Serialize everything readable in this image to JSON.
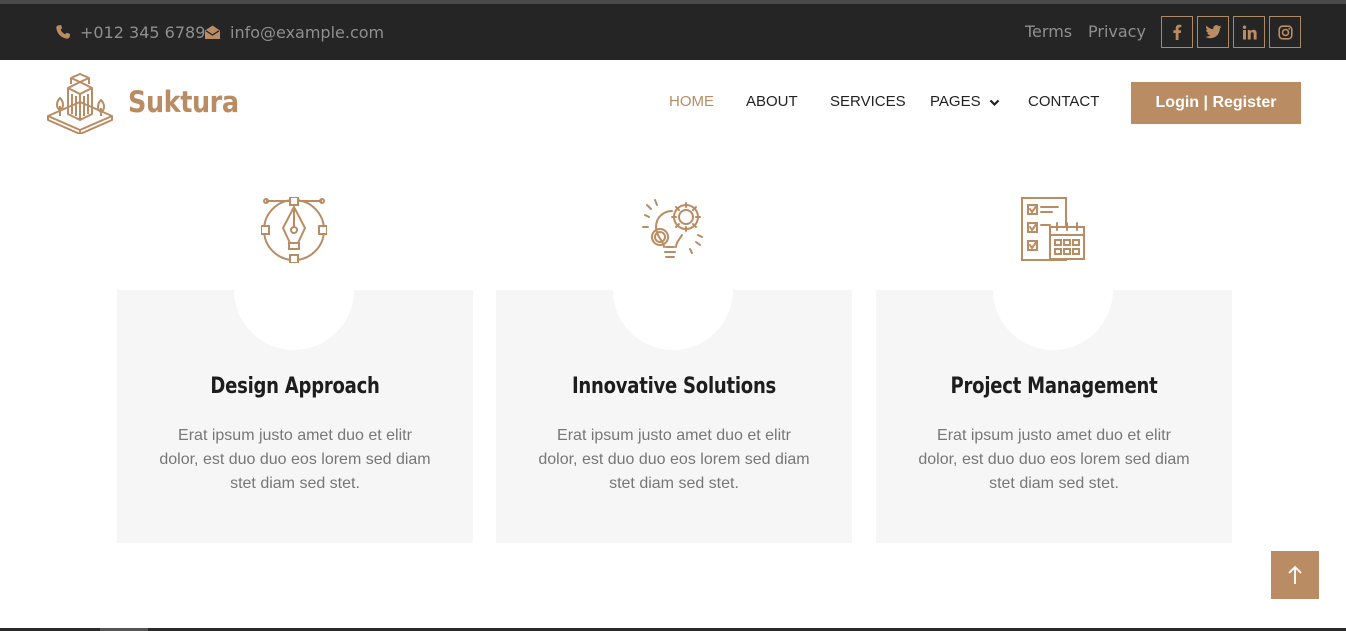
{
  "topbar": {
    "phone": "+012 345 6789",
    "email": "info@example.com",
    "terms": "Terms",
    "privacy": "Privacy",
    "social": [
      "facebook-icon",
      "twitter-icon",
      "linkedin-icon",
      "instagram-icon"
    ]
  },
  "brand": {
    "name": "Suktura",
    "logo_icon": "building-icon"
  },
  "nav": {
    "home": "HOME",
    "about": "ABOUT",
    "services": "SERVICES",
    "pages": "PAGES",
    "contact": "CONTACT",
    "active": "HOME",
    "login": "Login | Register"
  },
  "cards": [
    {
      "icon": "pen-tool-icon",
      "title": "Design Approach",
      "text": "Erat ipsum justo amet duo et elitr dolor, est duo duo eos lorem sed diam stet diam sed stet."
    },
    {
      "icon": "lightbulb-gear-icon",
      "title": "Innovative Solutions",
      "text": "Erat ipsum justo amet duo et elitr dolor, est duo duo eos lorem sed diam stet diam sed stet."
    },
    {
      "icon": "checklist-calendar-icon",
      "title": "Project Management",
      "text": "Erat ipsum justo amet duo et elitr dolor, est duo duo eos lorem sed diam stet diam sed stet."
    }
  ],
  "colors": {
    "accent": "#b98c63",
    "topbar_bg": "#252525",
    "card_bg": "#f6f6f6",
    "heading": "#1d1d1d"
  },
  "back_to_top_icon": "arrow-up-icon"
}
